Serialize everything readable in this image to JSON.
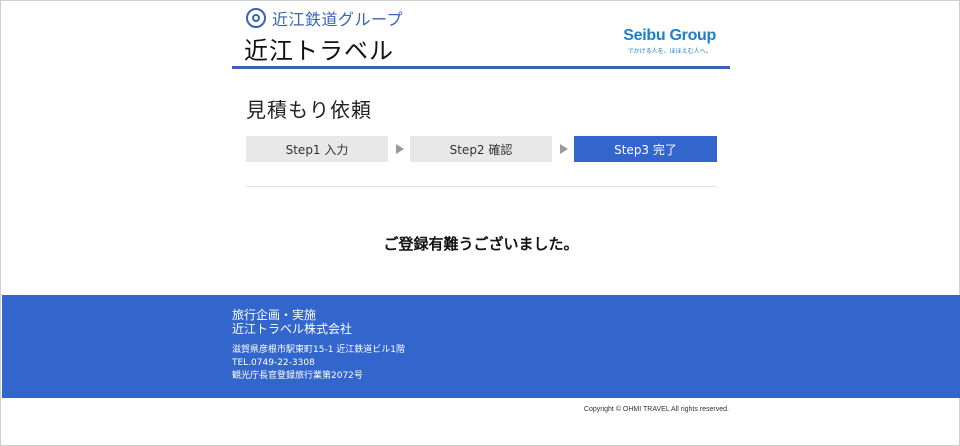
{
  "header": {
    "group_name": "近江鉄道グループ",
    "site_title": "近江トラベル",
    "partner_name": "Seibu Group",
    "partner_tagline": "でかける人を、ほほえむ人へ。"
  },
  "page": {
    "title": "見積もり依頼"
  },
  "steps": [
    {
      "label": "Step1 入力",
      "active": false
    },
    {
      "label": "Step2 確認",
      "active": false
    },
    {
      "label": "Step3 完了",
      "active": true
    }
  ],
  "main": {
    "message": "ご登録有難うございました。"
  },
  "footer": {
    "line1": "旅行企画・実施",
    "company": "近江トラベル株式会社",
    "address": "滋賀県彦根市駅東町15-1 近江鉄道ビル1階",
    "tel": "TEL.0749-22-3308",
    "license": "観光庁長官登録旅行業第2072号",
    "copyright": "Copyright © OHMI TRAVEL All rights reserved."
  },
  "colors": {
    "brand_blue": "#3366cc",
    "header_rule": "#3a63b8",
    "seibu_blue": "#1e7ec8",
    "step_inactive": "#e8e8e8"
  }
}
